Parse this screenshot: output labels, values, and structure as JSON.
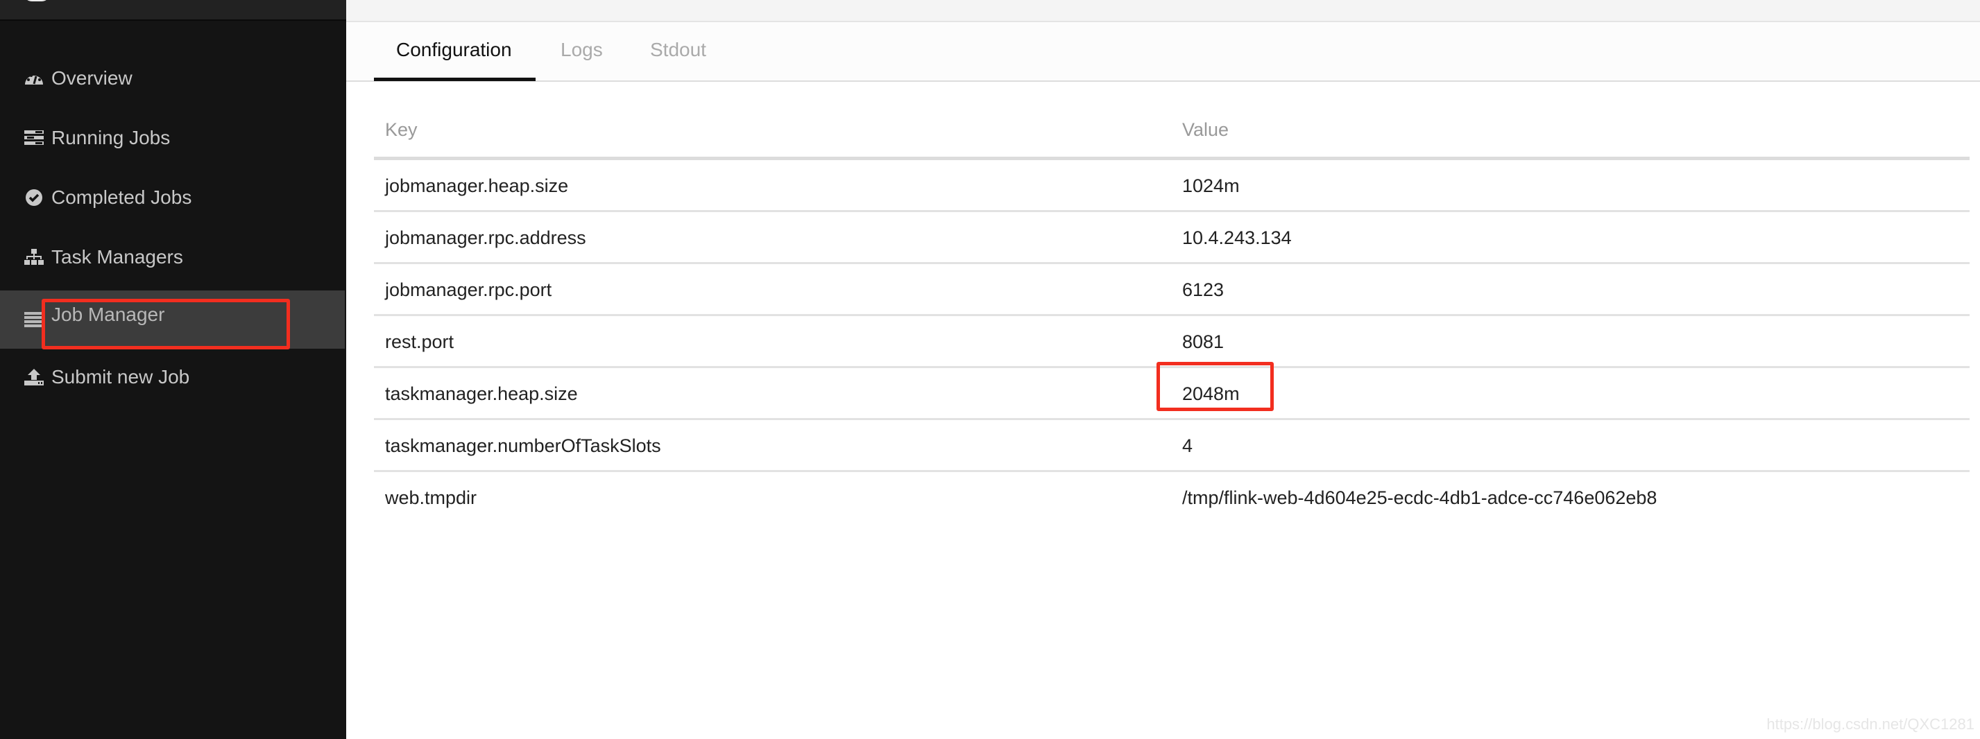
{
  "sidebar": {
    "items": [
      {
        "label": "Overview",
        "icon": "dashboard-icon"
      },
      {
        "label": "Running Jobs",
        "icon": "tasks-icon"
      },
      {
        "label": "Completed Jobs",
        "icon": "check-circle-icon"
      },
      {
        "label": "Task Managers",
        "icon": "sitemap-icon"
      },
      {
        "label": "Job Manager",
        "icon": "list-icon",
        "active": true
      },
      {
        "label": "Submit new Job",
        "icon": "upload-icon"
      }
    ]
  },
  "tabs": [
    {
      "label": "Configuration",
      "active": true
    },
    {
      "label": "Logs"
    },
    {
      "label": "Stdout"
    }
  ],
  "table": {
    "headers": {
      "key": "Key",
      "value": "Value"
    },
    "rows": [
      {
        "key": "jobmanager.heap.size",
        "value": "1024m"
      },
      {
        "key": "jobmanager.rpc.address",
        "value": "10.4.243.134"
      },
      {
        "key": "jobmanager.rpc.port",
        "value": "6123"
      },
      {
        "key": "rest.port",
        "value": "8081"
      },
      {
        "key": "taskmanager.heap.size",
        "value": "2048m"
      },
      {
        "key": "taskmanager.numberOfTaskSlots",
        "value": "4"
      },
      {
        "key": "web.tmpdir",
        "value": "/tmp/flink-web-4d604e25-ecdc-4db1-adce-cc746e062eb8"
      }
    ]
  },
  "annotation_color": "#f22e1f",
  "watermark": "https://blog.csdn.net/QXC1281"
}
